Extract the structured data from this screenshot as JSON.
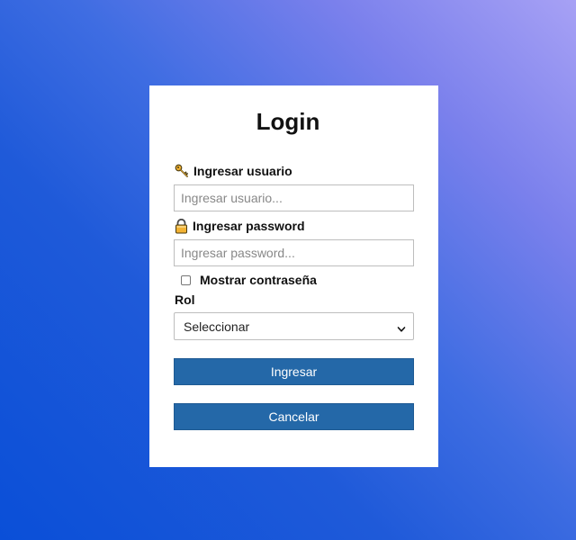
{
  "login": {
    "title": "Login",
    "username": {
      "label": "Ingresar usuario",
      "placeholder": "Ingresar usuario...",
      "value": "",
      "icon": "key-icon"
    },
    "password": {
      "label": "Ingresar password",
      "placeholder": "Ingresar password...",
      "value": "",
      "icon": "lock-icon"
    },
    "show_password": {
      "label": "Mostrar contraseña",
      "checked": false
    },
    "role": {
      "label": "Rol",
      "selected": "Seleccionar"
    },
    "submit_label": "Ingresar",
    "cancel_label": "Cancelar"
  },
  "colors": {
    "button": "#2468a8",
    "card": "#ffffff",
    "gradient_light": "#a7a1f5",
    "gradient_dark": "#0a4fd8"
  }
}
